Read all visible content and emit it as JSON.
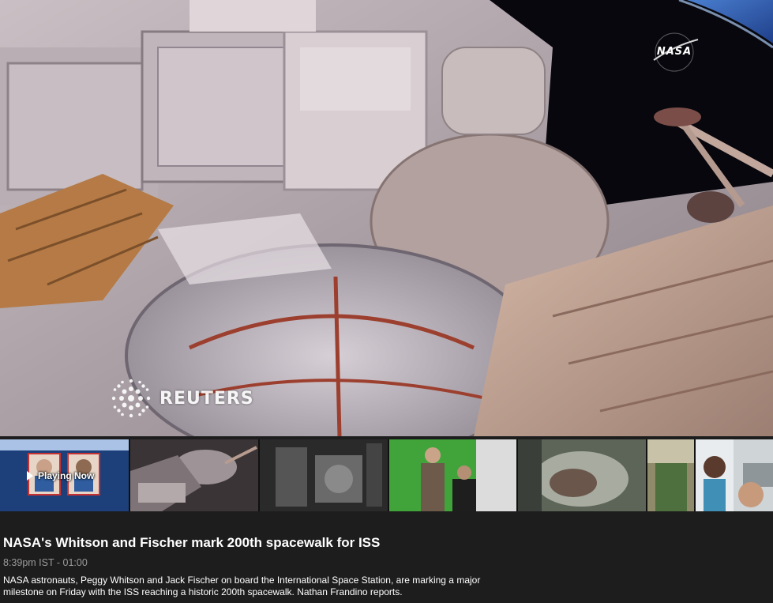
{
  "player": {
    "overlay_logo": "NASA",
    "watermark": "REUTERS"
  },
  "playlist": {
    "now_playing_label": "Playing Now"
  },
  "video": {
    "title": "NASA's Whitson and Fischer mark 200th spacewalk for ISS",
    "meta": "8:39pm IST - 01:00",
    "description": "NASA astronauts, Peggy Whitson and Jack Fischer on board the International Space Station, are marking a major milestone on Friday with the ISS reaching a historic 200th spacewalk. Nathan Frandino reports."
  },
  "colors": {
    "background": "#1d1d1d",
    "active_accent": "#f28b00",
    "meta_text": "#9a9a9a"
  },
  "icons": [
    "play-icon",
    "reuters-logo-icon",
    "nasa-logo-icon"
  ]
}
